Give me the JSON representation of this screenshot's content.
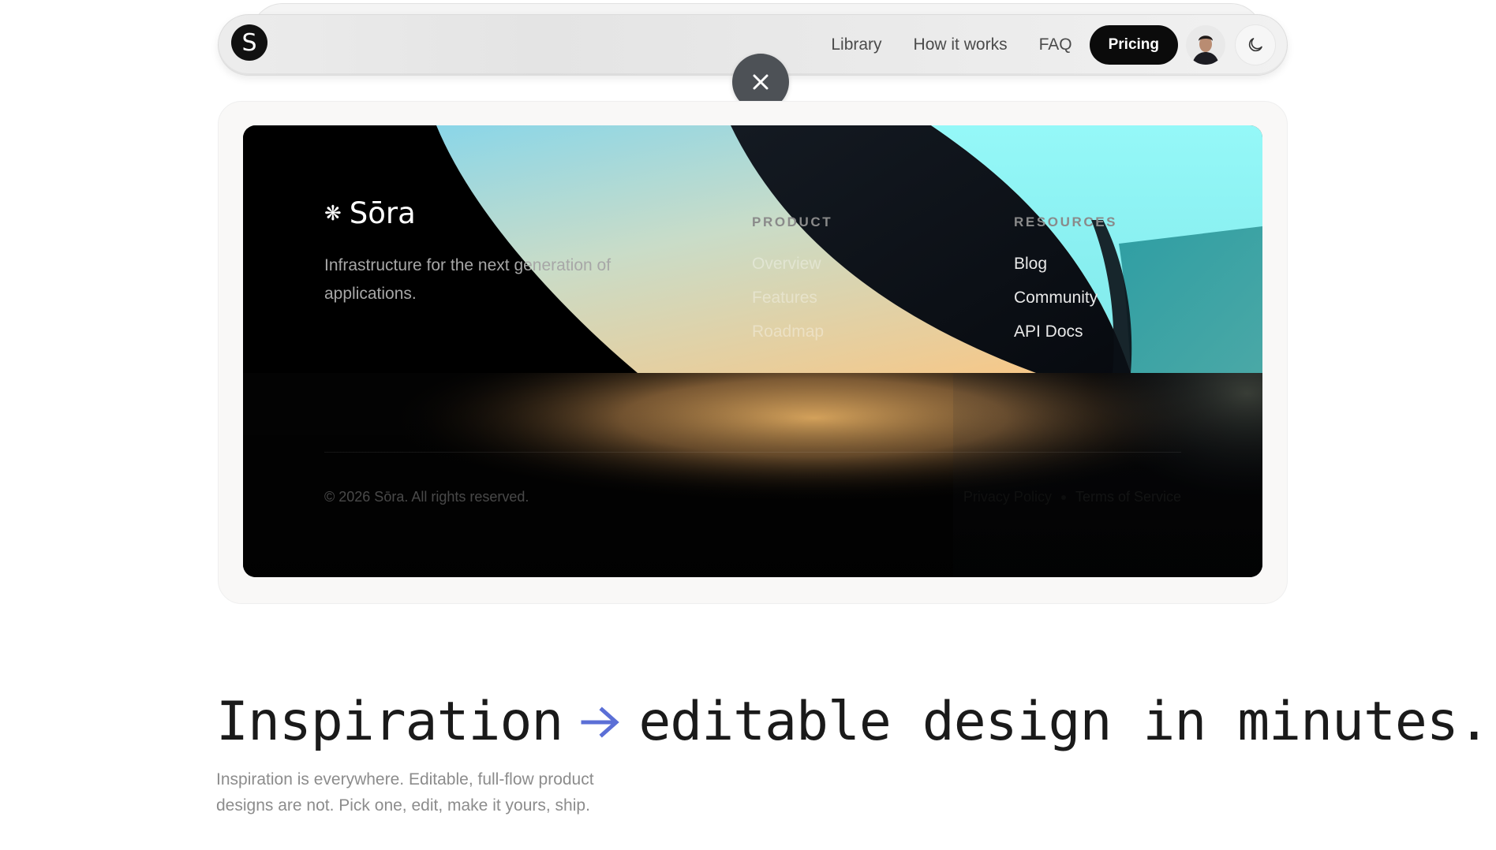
{
  "nav": {
    "logo_letter": "S",
    "links": [
      "Library",
      "How it works",
      "FAQ"
    ],
    "pricing_label": "Pricing",
    "theme_icon": "moon-icon",
    "close_icon": "close-icon"
  },
  "footer": {
    "brand_icon": "❋",
    "brand_name": "Sōra",
    "tagline": "Infrastructure for the next generation of applications.",
    "product_heading": "PRODUCT",
    "product_links": [
      "Overview",
      "Features",
      "Roadmap"
    ],
    "resources_heading": "RESOURCES",
    "resources_links": [
      "Blog",
      "Community",
      "API Docs"
    ],
    "copyright": "© 2026 Sōra. All rights reserved.",
    "privacy": "Privacy Policy",
    "terms": "Terms of Service"
  },
  "hero": {
    "title_left": "Inspiration",
    "title_right": "editable design in minutes.",
    "subtitle": "Inspiration is everywhere. Editable, full-flow product designs are not. Pick one, edit, make it yours, ship."
  },
  "colors": {
    "arrow": "#5b6fd6",
    "accent_dark": "#0b0b0b",
    "cyan": "#8ff7f7",
    "peach": "#f6c98a"
  }
}
